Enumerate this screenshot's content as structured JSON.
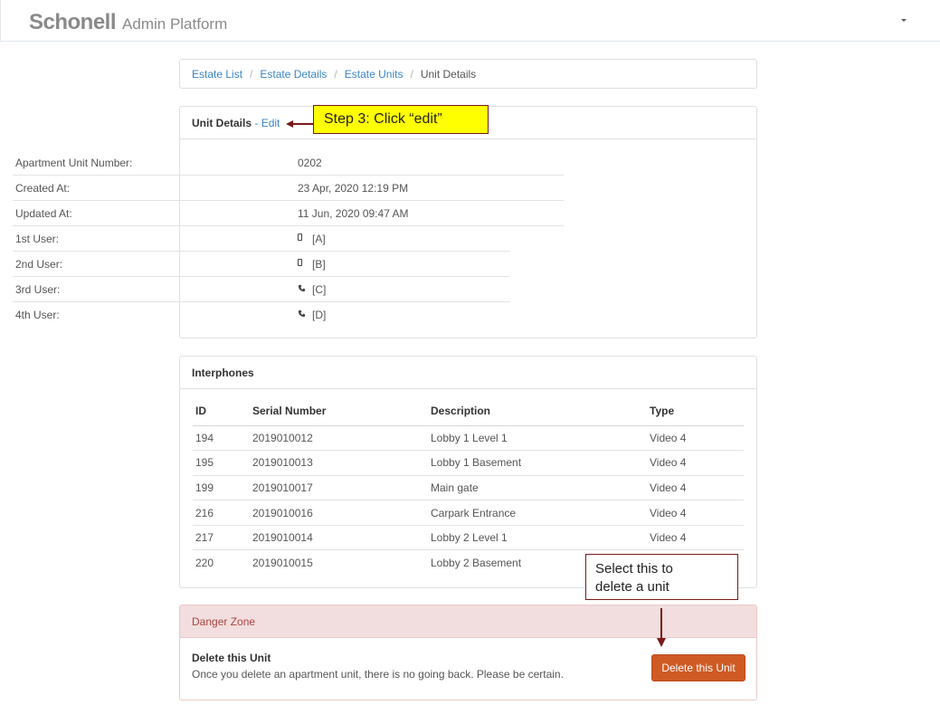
{
  "header": {
    "logo": "Schonell",
    "subtitle": "Admin Platform"
  },
  "breadcrumb": {
    "items": [
      "Estate List",
      "Estate Details",
      "Estate Units"
    ],
    "current": "Unit Details"
  },
  "unit_details": {
    "title": "Unit Details",
    "separator": " - ",
    "edit_label": "Edit",
    "rows": [
      {
        "label": "Apartment Unit Number:",
        "value": "0202"
      },
      {
        "label": "Created At:",
        "value": "23 Apr, 2020 12:19 PM"
      },
      {
        "label": "Updated At:",
        "value": "11 Jun, 2020 09:47 AM"
      },
      {
        "label": "1st User:",
        "value": "[A]",
        "icon": "mobile-icon"
      },
      {
        "label": "2nd User:",
        "value": "[B]",
        "icon": "mobile-icon"
      },
      {
        "label": "3rd User:",
        "value": "[C]",
        "icon": "phone-icon"
      },
      {
        "label": "4th User:",
        "value": "[D]",
        "icon": "phone-icon"
      }
    ]
  },
  "interphones": {
    "title": "Interphones",
    "columns": [
      "ID",
      "Serial Number",
      "Description",
      "Type"
    ],
    "rows": [
      [
        "194",
        "2019010012",
        "Lobby 1 Level 1",
        "Video 4"
      ],
      [
        "195",
        "2019010013",
        "Lobby 1 Basement",
        "Video 4"
      ],
      [
        "199",
        "2019010017",
        "Main gate",
        "Video 4"
      ],
      [
        "216",
        "2019010016",
        "Carpark Entrance",
        "Video 4"
      ],
      [
        "217",
        "2019010014",
        "Lobby 2 Level 1",
        "Video 4"
      ],
      [
        "220",
        "2019010015",
        "Lobby 2 Basement",
        ""
      ]
    ]
  },
  "danger_zone": {
    "title": "Danger Zone",
    "heading": "Delete this Unit",
    "text": "Once you delete an apartment unit, there is no going back. Please be certain.",
    "button_label": "Delete this Unit"
  },
  "annotations": {
    "step3": "Step 3: Click “edit”",
    "delete_line1": "Select this to",
    "delete_line2": "delete a unit"
  },
  "colors": {
    "link": "#3a85c6",
    "danger_bg": "#f2dede",
    "danger_text": "#a94442",
    "delete_button": "#cf5a24",
    "callout_yellow": "#ffff00",
    "arrow": "#7a1a1a"
  }
}
